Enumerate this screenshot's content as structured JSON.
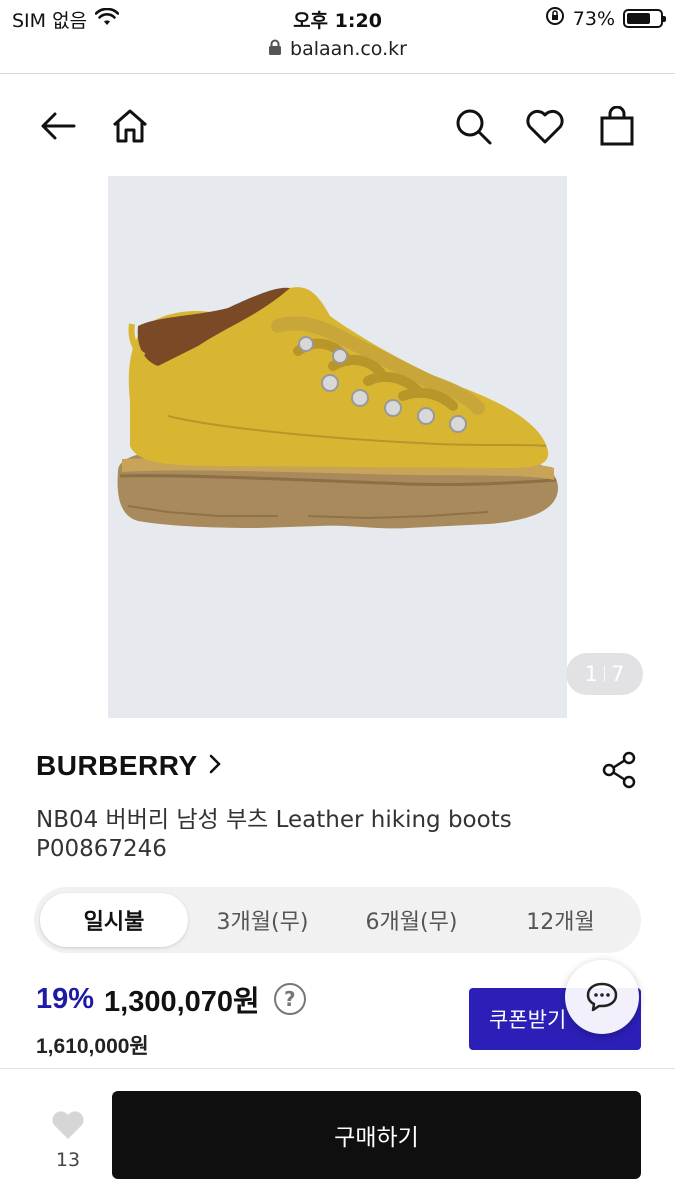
{
  "status_bar": {
    "carrier": "SIM 없음",
    "time": "오후 1:20",
    "battery": "73%",
    "battery_level": 0.73
  },
  "browser": {
    "url": "balaan.co.kr"
  },
  "nav": {
    "icons": [
      "back-arrow-icon",
      "home-icon",
      "search-icon",
      "heart-icon",
      "shopping-bag-icon"
    ]
  },
  "gallery": {
    "current": "1",
    "total": "7"
  },
  "product": {
    "brand": "BURBERRY",
    "name": "NB04 버버리 남성 부츠 Leather hiking boots",
    "code": "P00867246"
  },
  "installment_tabs": [
    {
      "label": "일시불",
      "active": true
    },
    {
      "label": "3개월(무)",
      "active": false
    },
    {
      "label": "6개월(무)",
      "active": false
    },
    {
      "label": "12개월",
      "active": false
    }
  ],
  "price": {
    "discount": "19%",
    "sale_price": "1,300,070원",
    "help": "?",
    "original_price": "1,610,000원"
  },
  "coupon_button": "쿠폰받기",
  "bottom_bar": {
    "like_count": "13",
    "buy_button": "구매하기"
  },
  "colors": {
    "accent": "#2b1fb7",
    "discount": "#1d1aa6",
    "buy_button": "#0f0f0f",
    "boot_yellow": "#d9b632",
    "sole": "#a88a5c"
  }
}
